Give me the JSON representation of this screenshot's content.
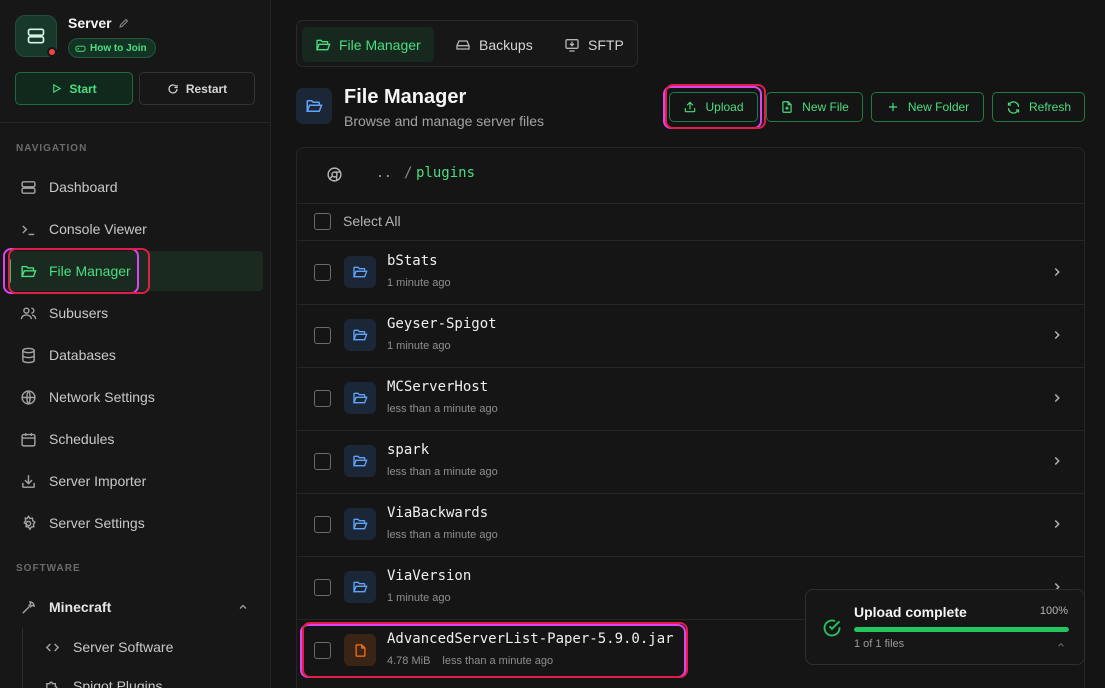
{
  "server": {
    "name": "Server",
    "how_to_join": "How to Join",
    "status_color": "#ef4444"
  },
  "power": {
    "start": "Start",
    "restart": "Restart"
  },
  "sidebar": {
    "nav_label": "NAVIGATION",
    "items": [
      {
        "label": "Dashboard",
        "icon": "server-icon"
      },
      {
        "label": "Console Viewer",
        "icon": "terminal-icon"
      },
      {
        "label": "File Manager",
        "icon": "folder-icon",
        "active": true
      },
      {
        "label": "Subusers",
        "icon": "users-icon"
      },
      {
        "label": "Databases",
        "icon": "database-icon"
      },
      {
        "label": "Network Settings",
        "icon": "globe-icon"
      },
      {
        "label": "Schedules",
        "icon": "calendar-icon"
      },
      {
        "label": "Server Importer",
        "icon": "import-icon"
      },
      {
        "label": "Server Settings",
        "icon": "gear-icon"
      }
    ],
    "software_label": "SOFTWARE",
    "software": {
      "group": "Minecraft",
      "items": [
        {
          "label": "Server Software",
          "icon": "code-icon"
        },
        {
          "label": "Spigot Plugins",
          "icon": "puzzle-icon"
        }
      ]
    }
  },
  "tabs": [
    {
      "label": "File Manager",
      "active": true
    },
    {
      "label": "Backups"
    },
    {
      "label": "SFTP"
    }
  ],
  "header": {
    "title": "File Manager",
    "subtitle": "Browse and manage server files"
  },
  "actions": {
    "upload": "Upload",
    "new_file": "New File",
    "new_folder": "New Folder",
    "refresh": "Refresh"
  },
  "breadcrumb": {
    "parent": "..",
    "separator": "/",
    "current": "plugins"
  },
  "list": {
    "select_all": "Select All",
    "rows": [
      {
        "name": "bStats",
        "meta": "1 minute ago",
        "type": "folder"
      },
      {
        "name": "Geyser-Spigot",
        "meta": "1 minute ago",
        "type": "folder"
      },
      {
        "name": "MCServerHost",
        "meta": "less than a minute ago",
        "type": "folder"
      },
      {
        "name": "spark",
        "meta": "less than a minute ago",
        "type": "folder"
      },
      {
        "name": "ViaBackwards",
        "meta": "less than a minute ago",
        "type": "folder"
      },
      {
        "name": "ViaVersion",
        "meta": "1 minute ago",
        "type": "folder"
      },
      {
        "name": "AdvancedServerList-Paper-5.9.0.jar",
        "size": "4.78 MiB",
        "meta": "less than a minute ago",
        "type": "file"
      }
    ]
  },
  "toast": {
    "title": "Upload complete",
    "percent_label": "100%",
    "progress": 1.0,
    "count": "1 of 1 files"
  },
  "colors": {
    "accent": "#22c55e",
    "folder": "#60a5fa",
    "file": "#f97316",
    "highlight_purple": "#d946ef",
    "highlight_red": "#e11d48"
  }
}
